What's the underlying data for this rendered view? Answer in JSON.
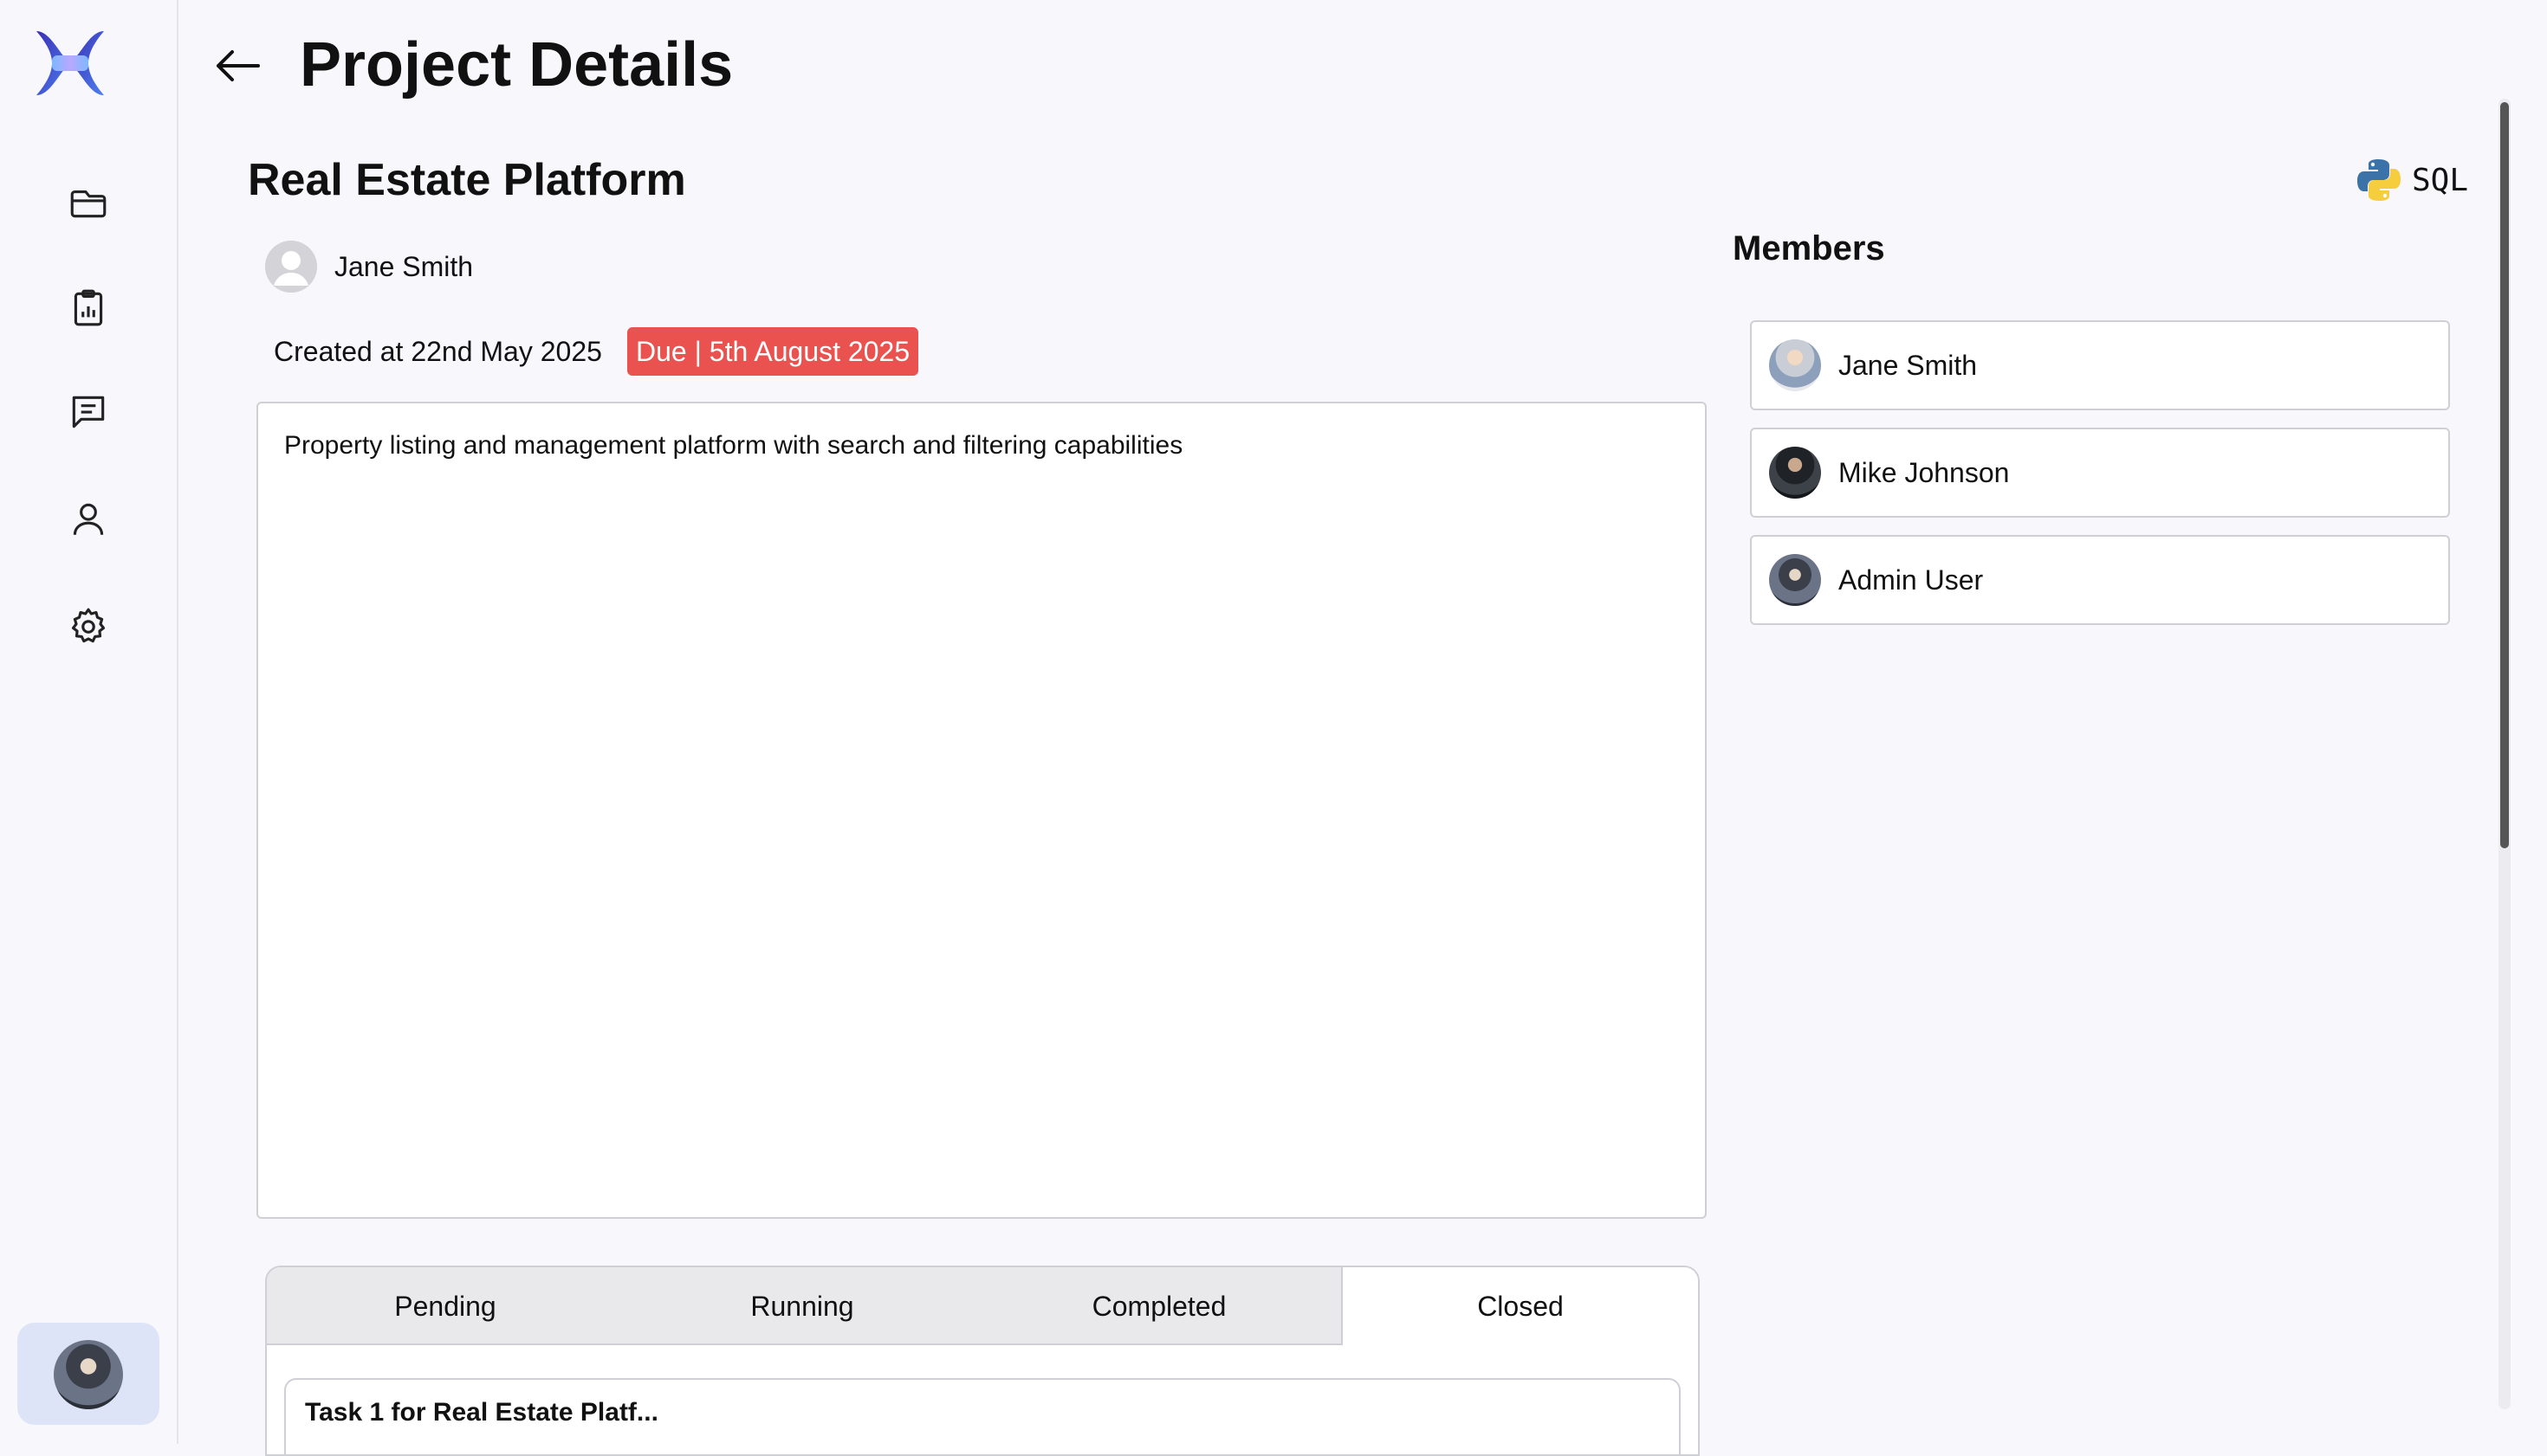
{
  "header": {
    "title": "Project Details"
  },
  "project": {
    "name": "Real Estate Platform",
    "owner": "Jane Smith",
    "created": "Created at 22nd May 2025",
    "due": "Due | 5th August 2025",
    "description": "Property listing and management platform with search and filtering capabilities",
    "tech_stack": {
      "icon": "python-icon",
      "label": "SQL"
    }
  },
  "tabs": [
    {
      "label": "Pending",
      "active": false
    },
    {
      "label": "Running",
      "active": false
    },
    {
      "label": "Completed",
      "active": false
    },
    {
      "label": "Closed",
      "active": true
    }
  ],
  "tasks": [
    {
      "title": "Task 1 for Real Estate Platf..."
    }
  ],
  "members": {
    "title": "Members",
    "items": [
      {
        "name": "Jane Smith"
      },
      {
        "name": "Mike Johnson"
      },
      {
        "name": "Admin User"
      }
    ]
  },
  "sidebar": {
    "icons": [
      "folder-icon",
      "clipboard-chart-icon",
      "chat-icon",
      "user-icon",
      "gear-icon"
    ]
  },
  "colors": {
    "accent": "#e9524f",
    "active_tile": "#dde4f8",
    "background": "#f7f7fc"
  }
}
